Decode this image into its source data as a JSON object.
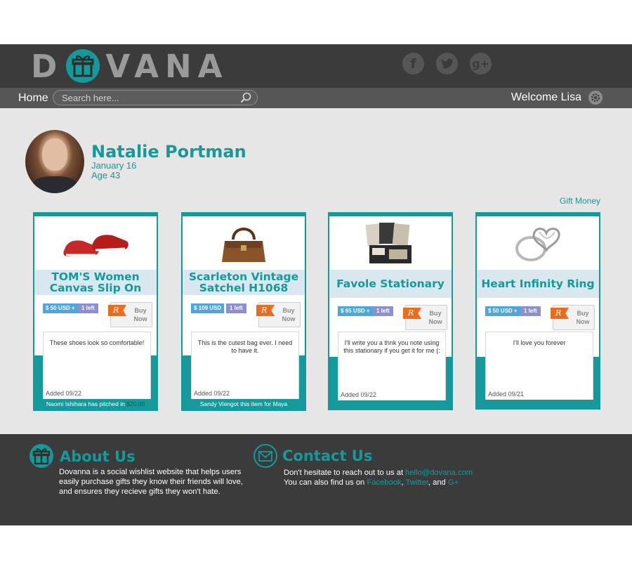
{
  "header": {
    "logo": {
      "before": "D",
      "after": "VANA"
    },
    "socials": [
      {
        "icon": "facebook-icon",
        "glyph": "f"
      },
      {
        "icon": "twitter-icon",
        "glyph": "t"
      },
      {
        "icon": "google-plus-icon",
        "glyph": "g+"
      }
    ]
  },
  "nav": {
    "home": "Home",
    "search_placeholder": "Search here...",
    "welcome": "Welcome Lisa"
  },
  "profile": {
    "name": "Natalie Portman",
    "birthday": "January 16",
    "age": "Age 43",
    "gift_money": "Gift Money"
  },
  "cards": [
    {
      "title": "TOM'S Women Canvas Slip On",
      "price": "$ 50 USD +",
      "left": "1 left",
      "buy_line1": "Buy",
      "buy_line2": "Now",
      "note": "These shoes look so comfortable!",
      "added": "Added 09/22",
      "footer_text": "Naomi Ishihara has pitched in ",
      "footer_amount": "$20.00"
    },
    {
      "title": "Scarleton Vintage Satchel H1068",
      "price": "$ 109 USD",
      "left": "1 left",
      "buy_line1": "Buy",
      "buy_line2": "Now",
      "note": "This is the cutest bag ever. I need to have it.",
      "added": "Added 09/22",
      "footer_text": "Sandy Viengot this item for Maya"
    },
    {
      "title": "Favole Stationary",
      "price": "$ 65 USD +",
      "left": "1 left",
      "buy_line1": "Buy",
      "buy_line2": "Now",
      "note": "I'll write you a thnk you note using this stationary if you get it for me (:",
      "added": "Added 09/22"
    },
    {
      "title": "Heart Infinity Ring",
      "price": "$ 50 USD +",
      "left": "1 left",
      "buy_line1": "Buy",
      "buy_line2": "Now",
      "note": "I'll love you forever",
      "added": "Added 09/21"
    }
  ],
  "footer": {
    "about": {
      "title": "About Us",
      "lines": [
        "Dovanna is a social wishlist website that helps users",
        "easily purchase gifts they know their friends will love,",
        "and ensures they recieve gifts they won't hate."
      ]
    },
    "contact": {
      "title": "Contact Us",
      "line1_text": "Don't hesitate to reach out to us at ",
      "email": "hello@dovana.com",
      "line2_text": "You can also find us on ",
      "facebook": "Facebook",
      "sep": ", ",
      "twitter": "Twitter",
      "and": ", and ",
      "gplus": "G+"
    }
  },
  "colors": {
    "accent": "#15999a",
    "header_bg": "#3b3b3b",
    "navbar_bg": "#565656",
    "main_bg": "#e6e6e6",
    "price_badge": "#4fa6dc",
    "left_badge": "#8d8fd0",
    "ribbon": "#ea6d1e"
  }
}
